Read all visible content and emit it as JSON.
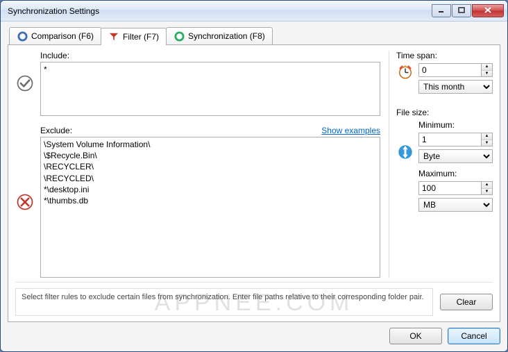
{
  "window": {
    "title": "Synchronization Settings"
  },
  "tabs": {
    "comparison": "Comparison (F6)",
    "filter": "Filter (F7)",
    "synchronization": "Synchronization (F8)"
  },
  "include": {
    "label": "Include:",
    "value": "*"
  },
  "exclude": {
    "label": "Exclude:",
    "link": "Show examples",
    "value": "\\System Volume Information\\\n\\$Recycle.Bin\\\n\\RECYCLER\\\n\\RECYCLED\\\n*\\desktop.ini\n*\\thumbs.db"
  },
  "timespan": {
    "label": "Time span:",
    "value": "0",
    "unit": "This month"
  },
  "filesize": {
    "label": "File size:",
    "min_label": "Minimum:",
    "min_value": "1",
    "min_unit": "Byte",
    "max_label": "Maximum:",
    "max_value": "100",
    "max_unit": "MB"
  },
  "hint": "Select filter rules to exclude certain files from synchronization. Enter file paths relative to their corresponding folder pair.",
  "buttons": {
    "clear": "Clear",
    "ok": "OK",
    "cancel": "Cancel"
  },
  "watermark": "APPNEE.COM"
}
